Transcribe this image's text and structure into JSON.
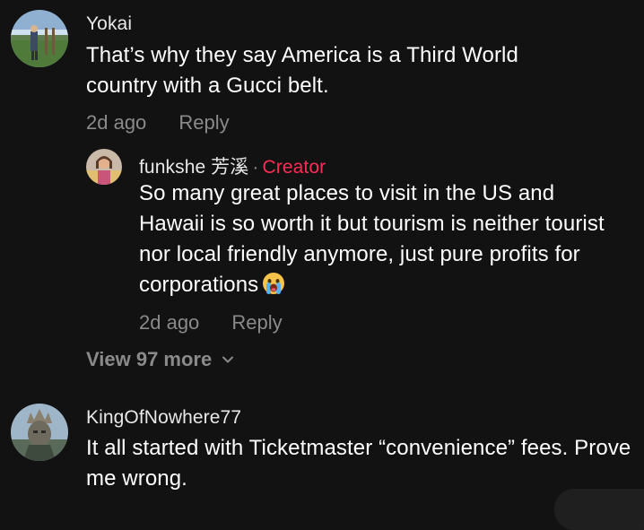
{
  "comments": [
    {
      "username": "Yokai",
      "text": "That’s why they say America is a Third World country with a Gucci belt.",
      "time": "2d ago",
      "reply_label": "Reply"
    },
    {
      "username": "KingOfNowhere77",
      "text": "It all started with Ticketmaster “convenience” fees. Prove me wrong."
    }
  ],
  "reply": {
    "username": "funkshe 芳溪",
    "separator": "·",
    "badge": "Creator",
    "text": "So many great places to visit in the US and Hawaii is so worth it but tourism is neither tourist nor local friendly anymore, just pure profits for corporations",
    "emoji": "loudly-crying-face",
    "time": "2d ago",
    "reply_label": "Reply"
  },
  "view_more": {
    "label": "View 97 more",
    "icon": "chevron-down-icon"
  },
  "colors": {
    "background": "#121212",
    "text": "#ffffff",
    "muted": "#8a8a8a",
    "creator": "#fe2c55"
  }
}
